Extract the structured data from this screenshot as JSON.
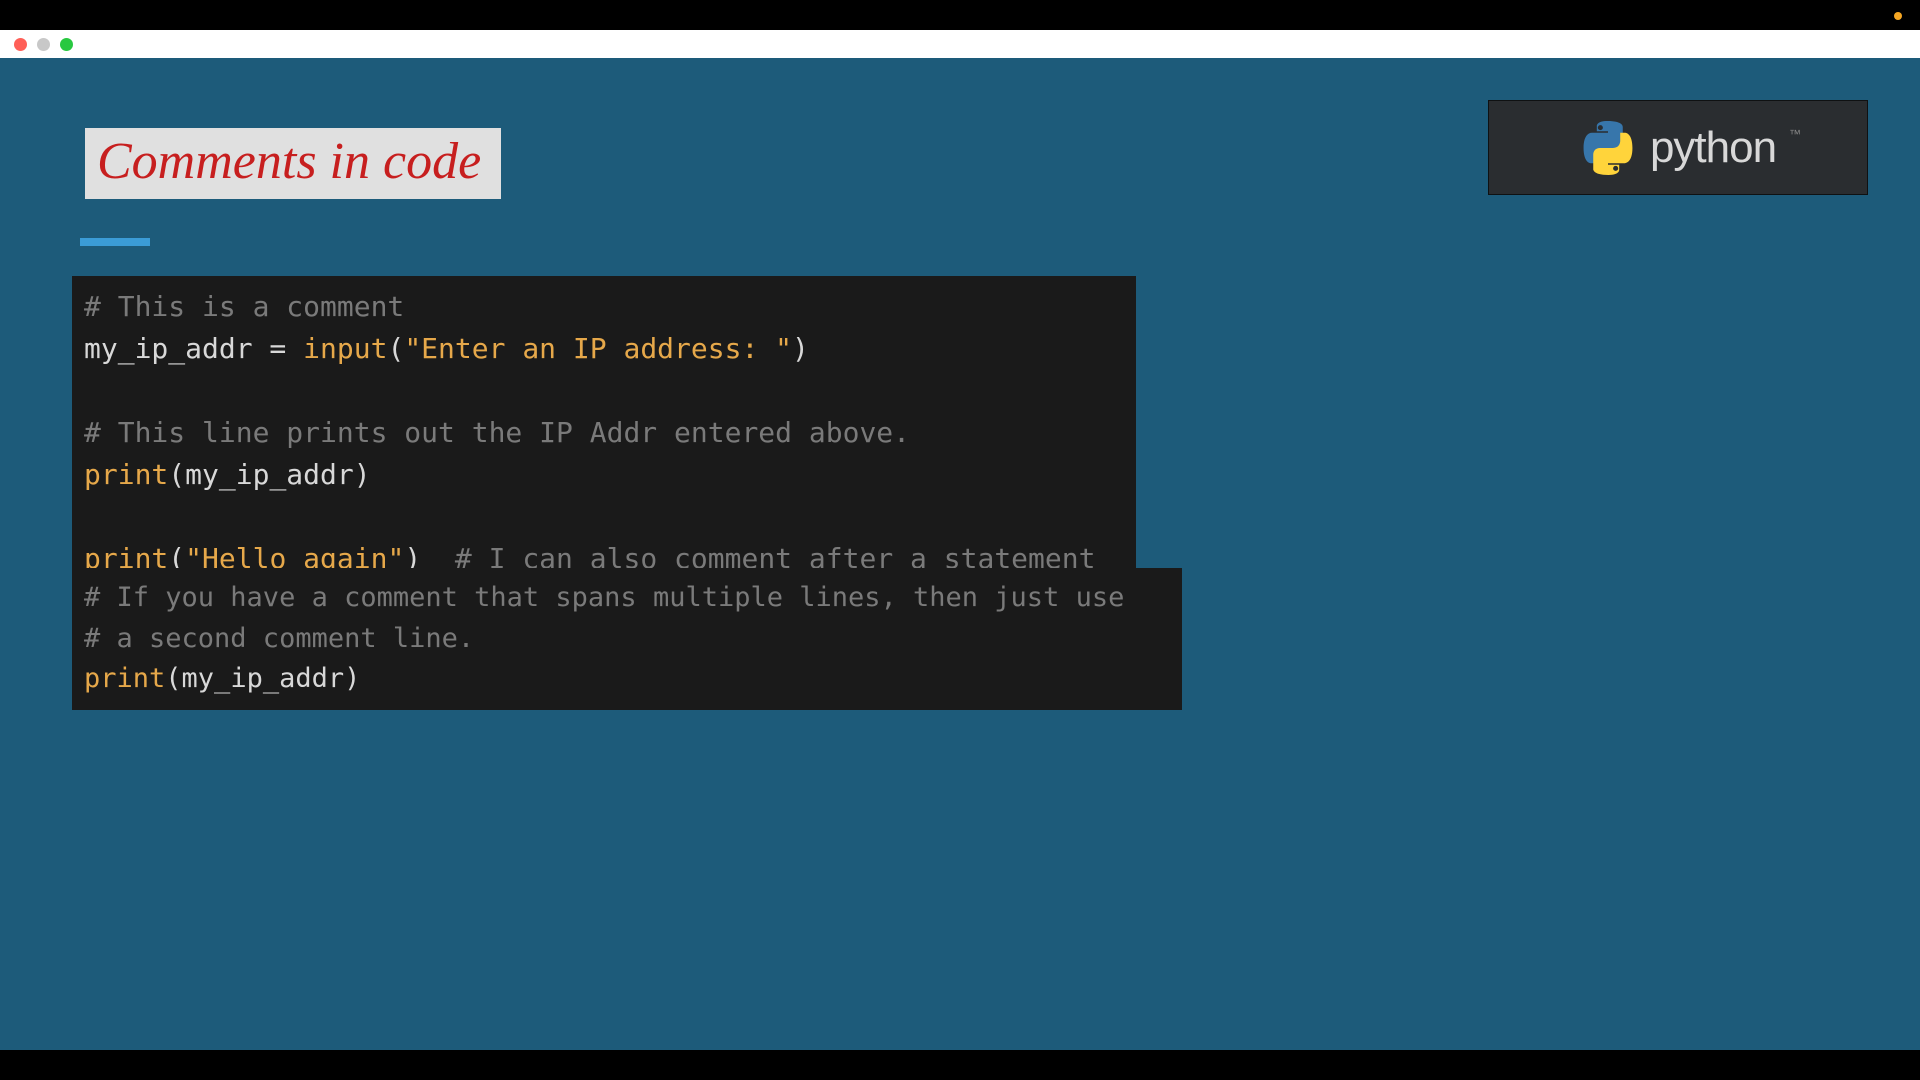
{
  "window": {
    "traffic_lights": [
      "close",
      "minimize",
      "zoom"
    ]
  },
  "slide": {
    "title": "Comments in code",
    "logo": {
      "text": "python",
      "tm": "™",
      "icon_name": "python-logo-icon"
    },
    "code_block_1": {
      "line1_comment": "# This is a comment",
      "line2_ident": "my_ip_addr",
      "line2_op": " = ",
      "line2_func": "input",
      "line2_paren_open": "(",
      "line2_string": "\"Enter an IP address: \"",
      "line2_paren_close": ")",
      "line3_blank": "",
      "line4_comment": "# This line prints out the IP Addr entered above.",
      "line5_func": "print",
      "line5_paren_open": "(",
      "line5_arg": "my_ip_addr",
      "line5_paren_close": ")",
      "line6_blank": "",
      "line7_func": "print",
      "line7_paren_open": "(",
      "line7_string": "\"Hello again\"",
      "line7_paren_close": ")",
      "line7_gap": "  ",
      "line7_comment": "# I can also comment after a statement"
    },
    "code_block_2": {
      "line1_comment": "# If you have a comment that spans multiple lines, then just use",
      "line2_comment": "# a second comment line.",
      "line3_func": "print",
      "line3_paren_open": "(",
      "line3_arg": "my_ip_addr",
      "line3_paren_close": ")"
    }
  }
}
